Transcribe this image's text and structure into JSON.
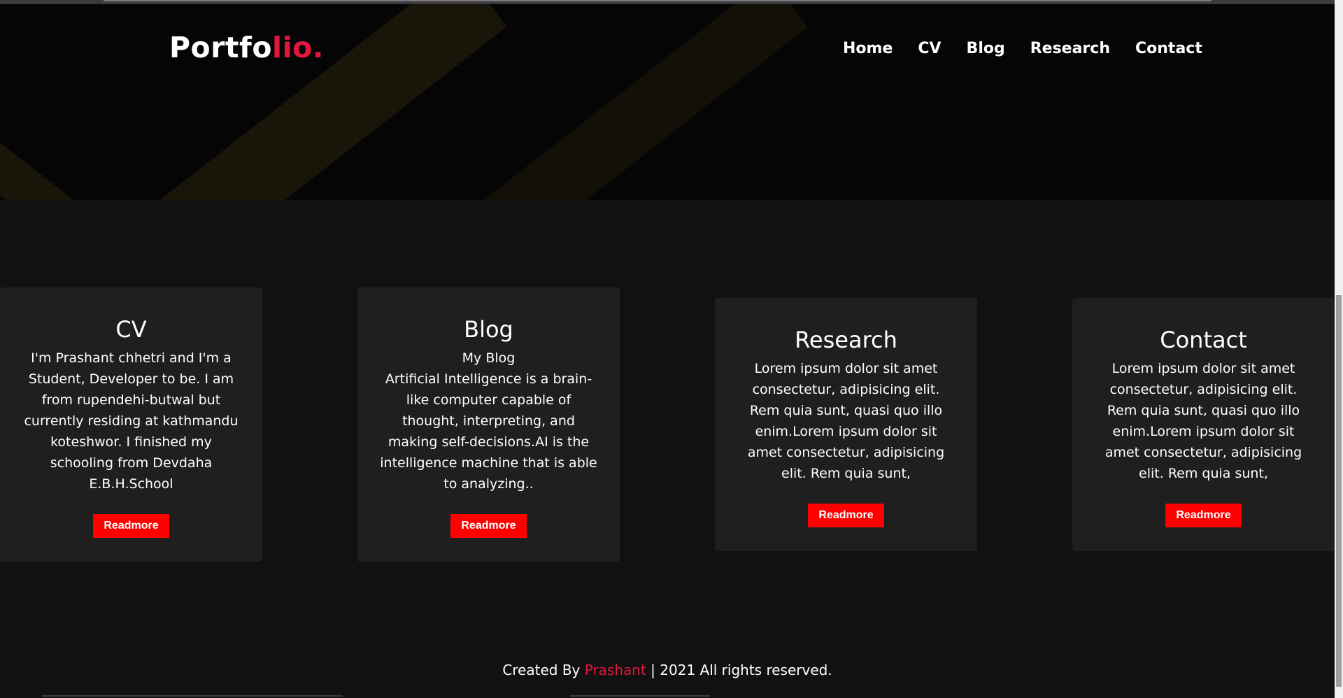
{
  "header": {
    "logo_main": "Portfo",
    "logo_accent": "lio.",
    "nav": [
      {
        "label": "Home"
      },
      {
        "label": "CV"
      },
      {
        "label": "Blog"
      },
      {
        "label": "Research"
      },
      {
        "label": "Contact"
      }
    ]
  },
  "cards": [
    {
      "title": "CV",
      "subtitle": "",
      "text": "I'm Prashant chhetri and I'm a Student, Developer to be. I am from rupendehi-butwal but currently residing at kathmandu koteshwor. I finished my schooling from Devdaha E.B.H.School",
      "button": "Readmore"
    },
    {
      "title": "Blog",
      "subtitle": "My Blog",
      "text": "Artificial Intelligence is a brain-like computer capable of thought, interpreting, and making self-decisions.AI is the intelligence machine that is able to analyzing..",
      "button": "Readmore"
    },
    {
      "title": "Research",
      "subtitle": "",
      "text": "Lorem ipsum dolor sit amet consectetur, adipisicing elit. Rem quia sunt, quasi quo illo enim.Lorem ipsum dolor sit amet consectetur, adipisicing elit. Rem quia sunt,",
      "button": "Readmore"
    },
    {
      "title": "Contact",
      "subtitle": "",
      "text": "Lorem ipsum dolor sit amet consectetur, adipisicing elit. Rem quia sunt, quasi quo illo enim.Lorem ipsum dolor sit amet consectetur, adipisicing elit. Rem quia sunt,",
      "button": "Readmore"
    }
  ],
  "footer": {
    "prefix": "Created By ",
    "name": "Prashant",
    "suffix": " | 2021 All rights reserved."
  },
  "colors": {
    "accent": "#e3173e",
    "button": "#ff0000",
    "card_bg": "#1f1f1f",
    "page_bg": "#111111",
    "hero_bg": "#050505"
  }
}
